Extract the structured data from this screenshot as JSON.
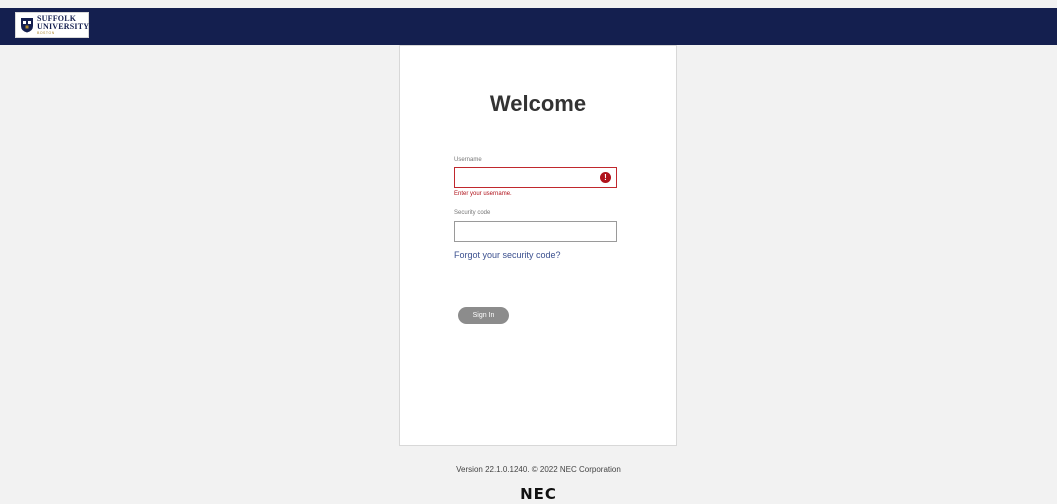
{
  "header": {
    "logo": {
      "line1": "SUFFOLK",
      "line2": "UNIVERSITY",
      "line3": "BOSTON",
      "brand_color": "#141f4f",
      "accent_color": "#b08a2e"
    },
    "bar_color": "#141f4f"
  },
  "login": {
    "title": "Welcome",
    "username_label": "Username",
    "username_value": "",
    "username_error": "Enter your username.",
    "error_icon": "exclamation-circle-icon",
    "error_color": "#b0121b",
    "security_label": "Security code",
    "security_value": "",
    "forgot_link": "Forgot your security code?",
    "sign_in_label": "Sign In"
  },
  "footer": {
    "version": "Version 22.1.0.1240.  © 2022 NEC Corporation",
    "logo_text": "NEC"
  }
}
